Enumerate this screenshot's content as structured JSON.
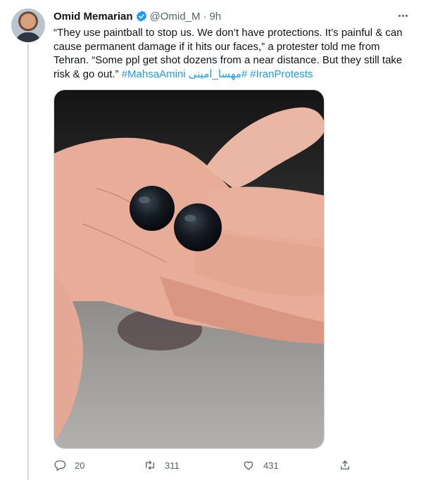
{
  "tweet": {
    "author_name": "Omid Memarian",
    "handle": "@Omid_M",
    "separator": "·",
    "time": "9h",
    "text_main": "“They use paintball to stop us. We don’t have protections. It’s painful & can cause permanent damage if it hits our faces,” a protester told me from Tehran. “Some ppl get shot dozens from a near distance. But they still take risk & go out.”",
    "hashtags": [
      "#MahsaAmini",
      "#مهسا_امینی",
      "#IranProtests"
    ],
    "media_alt": "hand holding two black paintball pellets"
  },
  "actions": {
    "reply_count": "20",
    "retweet_count": "311",
    "like_count": "431"
  },
  "colors": {
    "link": "#1d9bf0",
    "verified": "#1d9bf0",
    "secondary_text": "#536471",
    "divider": "#cfd9de"
  },
  "icons": [
    "verified-badge-icon",
    "more-options-icon",
    "reply-icon",
    "retweet-icon",
    "like-icon",
    "share-icon"
  ]
}
